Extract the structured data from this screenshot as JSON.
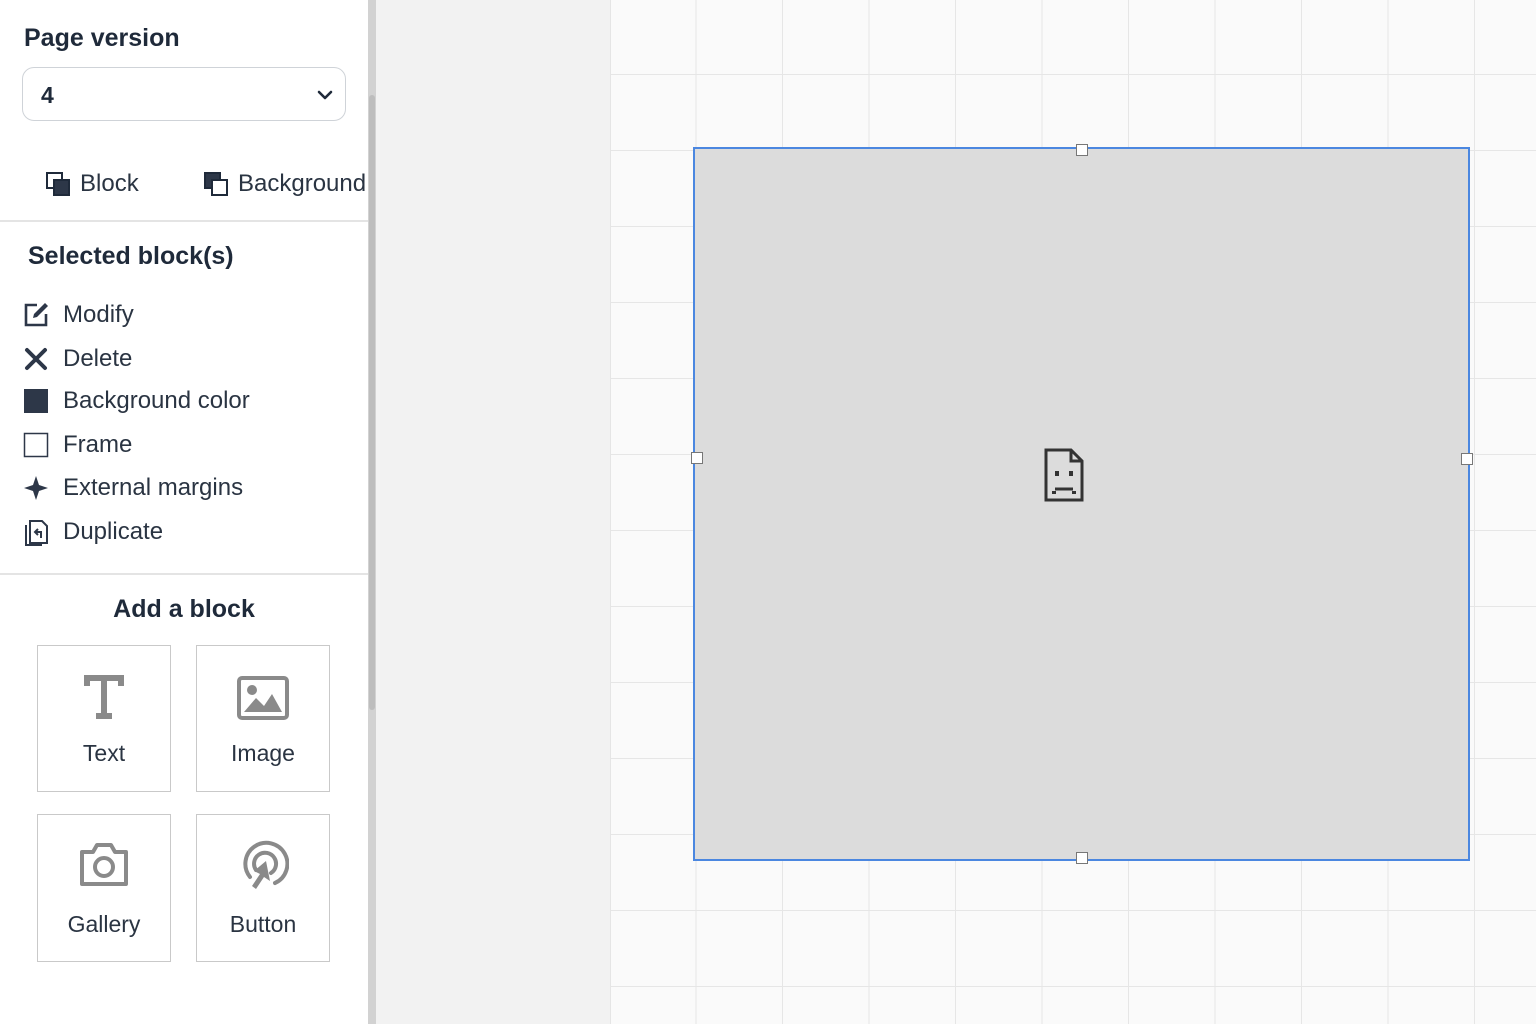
{
  "page_version": {
    "label": "Page version",
    "selected": "4"
  },
  "tabs": [
    {
      "label": "Block",
      "icon": "layers-block-icon"
    },
    {
      "label": "Background",
      "icon": "layers-background-icon"
    }
  ],
  "selected_blocks": {
    "title": "Selected block(s)",
    "actions": [
      {
        "label": "Modify",
        "icon": "edit-icon"
      },
      {
        "label": "Delete",
        "icon": "close-icon"
      },
      {
        "label": "Background color",
        "icon": "color-square-icon"
      },
      {
        "label": "Frame",
        "icon": "frame-square-icon"
      },
      {
        "label": "External margins",
        "icon": "margins-cross-icon"
      },
      {
        "label": "Duplicate",
        "icon": "duplicate-icon"
      }
    ]
  },
  "add_block": {
    "title": "Add a block",
    "items": [
      {
        "label": "Text",
        "icon": "text-icon"
      },
      {
        "label": "Image",
        "icon": "image-icon"
      },
      {
        "label": "Gallery",
        "icon": "camera-icon"
      },
      {
        "label": "Button",
        "icon": "cursor-click-icon"
      }
    ]
  },
  "colors": {
    "selection": "#4b87e0",
    "block_fill": "#dcdcdc",
    "text": "#1f2a3a",
    "icon_gray": "#8a8a8a"
  }
}
